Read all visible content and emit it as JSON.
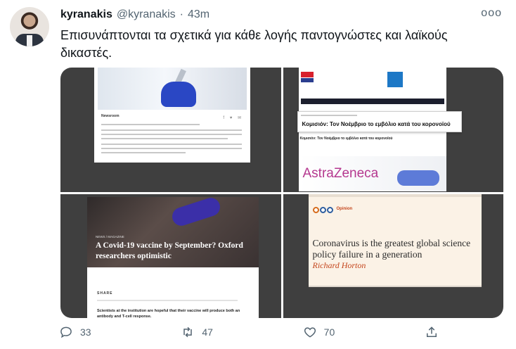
{
  "user": {
    "name": "kyranakis",
    "handle": "@kyranakis",
    "separator": "·",
    "time": "43m"
  },
  "more_label": "ooo",
  "tweet_text": "Επισυνάπτονται τα σχετικά για κάθε λογής παντογνώστες και λαϊκούς δικαστές.",
  "images": {
    "img1": {
      "source": "Newsroom",
      "share": "f ♥ ✉"
    },
    "img2": {
      "headline": "Κομισιόν: Τον Νοέμβριο το εμβόλιο κατά του κορονοϊού",
      "sub": "Κομισιόν: Τον Νοέμβριο το εμβόλιο κατά του κορονοϊού",
      "brand": "AstraZeneca"
    },
    "img3": {
      "category": "NEWS / MAGAZINE",
      "title": "A Covid-19 vaccine by September? Oxford researchers optimistic",
      "share": "SHARE",
      "body": "Scientists at the institution are hopeful that their vaccine will produce both an antibody and T-cell response."
    },
    "img4": {
      "label": "Opinion",
      "headline": "Coronavirus is the greatest global science policy failure in a generation",
      "author": "Richard Horton"
    }
  },
  "actions": {
    "reply_count": "33",
    "retweet_count": "47",
    "like_count": "70"
  }
}
